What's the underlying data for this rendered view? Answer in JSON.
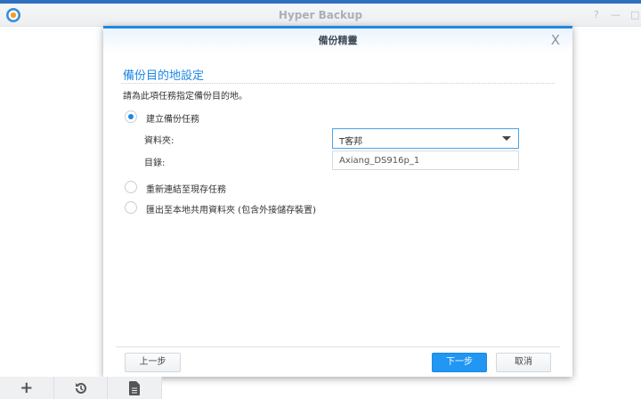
{
  "app": {
    "title": "Hyper Backup",
    "help": "?",
    "minimize": "—",
    "maximize": "□"
  },
  "dialog": {
    "title": "備份精靈",
    "close": "X",
    "section_title": "備份目的地設定",
    "description": "請為此項任務指定備份目的地。",
    "options": [
      {
        "label": "建立備份任務",
        "selected": true
      },
      {
        "label": "重新連結至現存任務",
        "selected": false
      },
      {
        "label": "匯出至本地共用資料夾 (包含外接儲存裝置)",
        "selected": false
      }
    ],
    "folder_label": "資料夾:",
    "folder_value": "T客邦",
    "directory_label": "目錄:",
    "directory_value": "Axiang_DS916p_1",
    "buttons": {
      "prev": "上一步",
      "next": "下一步",
      "cancel": "取消"
    }
  },
  "toolbar": {
    "add": "+",
    "history_icon": "history-icon",
    "log_icon": "log-icon"
  }
}
